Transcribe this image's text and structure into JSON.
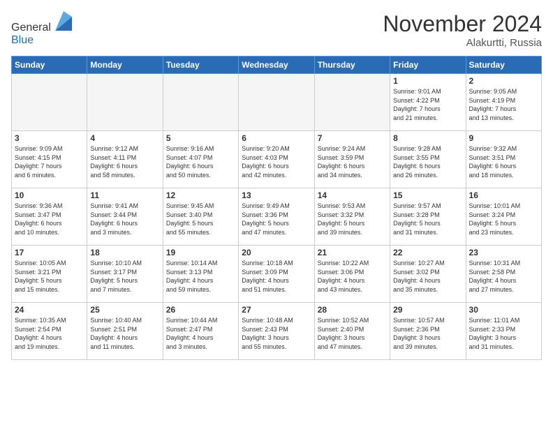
{
  "header": {
    "logo_general": "General",
    "logo_blue": "Blue",
    "month_title": "November 2024",
    "location": "Alakurtti, Russia"
  },
  "days_of_week": [
    "Sunday",
    "Monday",
    "Tuesday",
    "Wednesday",
    "Thursday",
    "Friday",
    "Saturday"
  ],
  "weeks": [
    [
      {
        "day": "",
        "info": ""
      },
      {
        "day": "",
        "info": ""
      },
      {
        "day": "",
        "info": ""
      },
      {
        "day": "",
        "info": ""
      },
      {
        "day": "",
        "info": ""
      },
      {
        "day": "1",
        "info": "Sunrise: 9:01 AM\nSunset: 4:22 PM\nDaylight: 7 hours\nand 21 minutes."
      },
      {
        "day": "2",
        "info": "Sunrise: 9:05 AM\nSunset: 4:19 PM\nDaylight: 7 hours\nand 13 minutes."
      }
    ],
    [
      {
        "day": "3",
        "info": "Sunrise: 9:09 AM\nSunset: 4:15 PM\nDaylight: 7 hours\nand 6 minutes."
      },
      {
        "day": "4",
        "info": "Sunrise: 9:12 AM\nSunset: 4:11 PM\nDaylight: 6 hours\nand 58 minutes."
      },
      {
        "day": "5",
        "info": "Sunrise: 9:16 AM\nSunset: 4:07 PM\nDaylight: 6 hours\nand 50 minutes."
      },
      {
        "day": "6",
        "info": "Sunrise: 9:20 AM\nSunset: 4:03 PM\nDaylight: 6 hours\nand 42 minutes."
      },
      {
        "day": "7",
        "info": "Sunrise: 9:24 AM\nSunset: 3:59 PM\nDaylight: 6 hours\nand 34 minutes."
      },
      {
        "day": "8",
        "info": "Sunrise: 9:28 AM\nSunset: 3:55 PM\nDaylight: 6 hours\nand 26 minutes."
      },
      {
        "day": "9",
        "info": "Sunrise: 9:32 AM\nSunset: 3:51 PM\nDaylight: 6 hours\nand 18 minutes."
      }
    ],
    [
      {
        "day": "10",
        "info": "Sunrise: 9:36 AM\nSunset: 3:47 PM\nDaylight: 6 hours\nand 10 minutes."
      },
      {
        "day": "11",
        "info": "Sunrise: 9:41 AM\nSunset: 3:44 PM\nDaylight: 6 hours\nand 3 minutes."
      },
      {
        "day": "12",
        "info": "Sunrise: 9:45 AM\nSunset: 3:40 PM\nDaylight: 5 hours\nand 55 minutes."
      },
      {
        "day": "13",
        "info": "Sunrise: 9:49 AM\nSunset: 3:36 PM\nDaylight: 5 hours\nand 47 minutes."
      },
      {
        "day": "14",
        "info": "Sunrise: 9:53 AM\nSunset: 3:32 PM\nDaylight: 5 hours\nand 39 minutes."
      },
      {
        "day": "15",
        "info": "Sunrise: 9:57 AM\nSunset: 3:28 PM\nDaylight: 5 hours\nand 31 minutes."
      },
      {
        "day": "16",
        "info": "Sunrise: 10:01 AM\nSunset: 3:24 PM\nDaylight: 5 hours\nand 23 minutes."
      }
    ],
    [
      {
        "day": "17",
        "info": "Sunrise: 10:05 AM\nSunset: 3:21 PM\nDaylight: 5 hours\nand 15 minutes."
      },
      {
        "day": "18",
        "info": "Sunrise: 10:10 AM\nSunset: 3:17 PM\nDaylight: 5 hours\nand 7 minutes."
      },
      {
        "day": "19",
        "info": "Sunrise: 10:14 AM\nSunset: 3:13 PM\nDaylight: 4 hours\nand 59 minutes."
      },
      {
        "day": "20",
        "info": "Sunrise: 10:18 AM\nSunset: 3:09 PM\nDaylight: 4 hours\nand 51 minutes."
      },
      {
        "day": "21",
        "info": "Sunrise: 10:22 AM\nSunset: 3:06 PM\nDaylight: 4 hours\nand 43 minutes."
      },
      {
        "day": "22",
        "info": "Sunrise: 10:27 AM\nSunset: 3:02 PM\nDaylight: 4 hours\nand 35 minutes."
      },
      {
        "day": "23",
        "info": "Sunrise: 10:31 AM\nSunset: 2:58 PM\nDaylight: 4 hours\nand 27 minutes."
      }
    ],
    [
      {
        "day": "24",
        "info": "Sunrise: 10:35 AM\nSunset: 2:54 PM\nDaylight: 4 hours\nand 19 minutes."
      },
      {
        "day": "25",
        "info": "Sunrise: 10:40 AM\nSunset: 2:51 PM\nDaylight: 4 hours\nand 11 minutes."
      },
      {
        "day": "26",
        "info": "Sunrise: 10:44 AM\nSunset: 2:47 PM\nDaylight: 4 hours\nand 3 minutes."
      },
      {
        "day": "27",
        "info": "Sunrise: 10:48 AM\nSunset: 2:43 PM\nDaylight: 3 hours\nand 55 minutes."
      },
      {
        "day": "28",
        "info": "Sunrise: 10:52 AM\nSunset: 2:40 PM\nDaylight: 3 hours\nand 47 minutes."
      },
      {
        "day": "29",
        "info": "Sunrise: 10:57 AM\nSunset: 2:36 PM\nDaylight: 3 hours\nand 39 minutes."
      },
      {
        "day": "30",
        "info": "Sunrise: 11:01 AM\nSunset: 2:33 PM\nDaylight: 3 hours\nand 31 minutes."
      }
    ]
  ]
}
